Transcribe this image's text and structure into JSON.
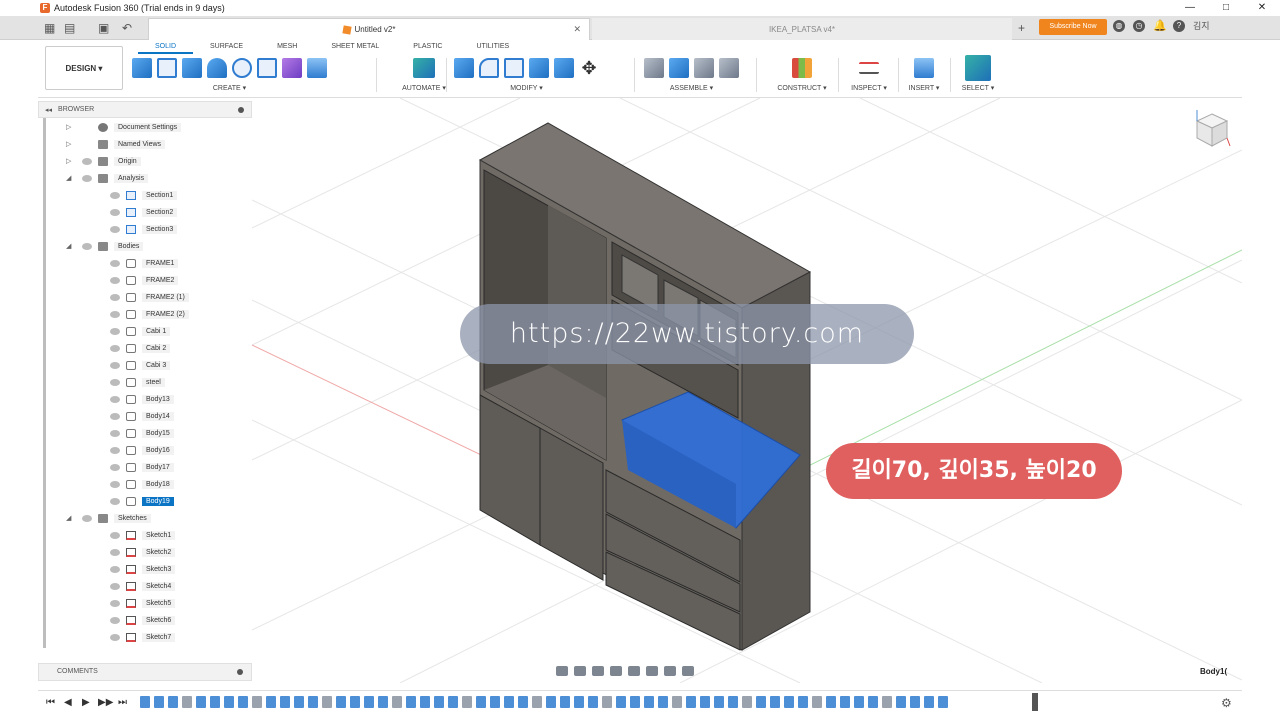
{
  "window": {
    "title": "Autodesk Fusion 360 (Trial ends in 9 days)",
    "controls": [
      "—",
      "□",
      "✕"
    ]
  },
  "tabs": [
    {
      "label": "Untitled v2*",
      "active": true
    },
    {
      "label": "IKEA_PLATSA v4*",
      "active": false
    }
  ],
  "header_right": {
    "subscribe_label": "Subscribe Now",
    "user": "김지"
  },
  "ribbon_tabs": [
    "SOLID",
    "SURFACE",
    "MESH",
    "SHEET METAL",
    "PLASTIC",
    "UTILITIES"
  ],
  "design_label": "DESIGN ▾",
  "tool_groups": [
    "CREATE ▾",
    "AUTOMATE ▾",
    "MODIFY ▾",
    "ASSEMBLE ▾",
    "CONSTRUCT ▾",
    "INSPECT ▾",
    "INSERT ▾",
    "SELECT ▾"
  ],
  "browser": {
    "title": "BROWSER",
    "items": [
      {
        "label": "Document Settings",
        "icon": "gear-icon",
        "level": 0
      },
      {
        "label": "Named Views",
        "icon": "folder-icon",
        "level": 0
      },
      {
        "label": "Origin",
        "icon": "folder-icon",
        "level": 0
      },
      {
        "label": "Analysis",
        "icon": "folder-icon",
        "level": 0
      },
      {
        "label": "Section1",
        "icon": "section-icon",
        "level": 1
      },
      {
        "label": "Section2",
        "icon": "section-icon",
        "level": 1
      },
      {
        "label": "Section3",
        "icon": "section-icon",
        "level": 1
      },
      {
        "label": "Bodies",
        "icon": "folder-icon",
        "level": 0
      },
      {
        "label": "FRAME1",
        "icon": "body-icon",
        "level": 1
      },
      {
        "label": "FRAME2",
        "icon": "body-icon",
        "level": 1
      },
      {
        "label": "FRAME2 (1)",
        "icon": "body-icon",
        "level": 1
      },
      {
        "label": "FRAME2 (2)",
        "icon": "body-icon",
        "level": 1
      },
      {
        "label": "Cabi 1",
        "icon": "body-icon",
        "level": 1
      },
      {
        "label": "Cabi 2",
        "icon": "body-icon",
        "level": 1
      },
      {
        "label": "Cabi 3",
        "icon": "body-icon",
        "level": 1
      },
      {
        "label": "steel",
        "icon": "body-icon",
        "level": 1
      },
      {
        "label": "Body13",
        "icon": "body-icon",
        "level": 1
      },
      {
        "label": "Body14",
        "icon": "body-icon",
        "level": 1
      },
      {
        "label": "Body15",
        "icon": "body-icon",
        "level": 1
      },
      {
        "label": "Body16",
        "icon": "body-icon",
        "level": 1
      },
      {
        "label": "Body17",
        "icon": "body-icon",
        "level": 1
      },
      {
        "label": "Body18",
        "icon": "body-icon",
        "level": 1
      },
      {
        "label": "Body19",
        "icon": "body-icon",
        "level": 1,
        "selected": true
      },
      {
        "label": "Sketches",
        "icon": "folder-icon",
        "level": 0
      },
      {
        "label": "Sketch1",
        "icon": "sketch-icon",
        "level": 1
      },
      {
        "label": "Sketch2",
        "icon": "sketch-icon",
        "level": 1
      },
      {
        "label": "Sketch3",
        "icon": "sketch-icon",
        "level": 1
      },
      {
        "label": "Sketch4",
        "icon": "sketch-icon",
        "level": 1
      },
      {
        "label": "Sketch5",
        "icon": "sketch-icon",
        "level": 1
      },
      {
        "label": "Sketch6",
        "icon": "sketch-icon",
        "level": 1
      },
      {
        "label": "Sketch7",
        "icon": "sketch-icon",
        "level": 1
      }
    ]
  },
  "comments_label": "COMMENTS",
  "status_body": "Body1(",
  "overlays": {
    "url": "https://22ww.tistory.com",
    "dimensions": "길이70, 깊이35, 높이20"
  },
  "colors": {
    "accent": "#0b74c4",
    "selected_body": "#2f6fd6",
    "subscribe": "#f0851e",
    "cabinet": "#6f6a64"
  }
}
